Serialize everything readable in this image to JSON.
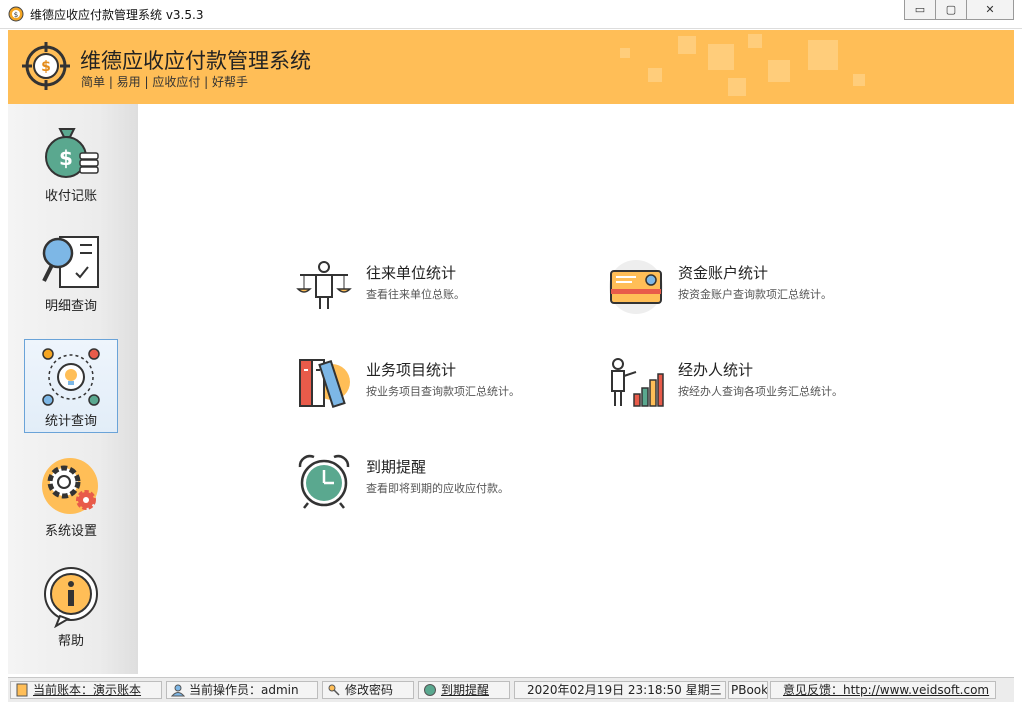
{
  "window": {
    "title": "维德应收应付款管理系统   v3.5.3",
    "controls": {
      "minimize": "▭",
      "maximize": "▢",
      "close": "✕"
    }
  },
  "header": {
    "title": "维德应收应付款管理系统",
    "subtitle": "简单 | 易用 | 应收应付 | 好帮手",
    "accent": "#ffbe57"
  },
  "sidebar": {
    "items": [
      {
        "label": "收付记账",
        "icon": "money-bag-icon"
      },
      {
        "label": "明细查询",
        "icon": "magnifier-report-icon"
      },
      {
        "label": "统计查询",
        "icon": "lightbulb-stats-icon",
        "active": true
      },
      {
        "label": "系统设置",
        "icon": "gears-icon"
      },
      {
        "label": "帮助",
        "icon": "info-icon"
      }
    ]
  },
  "main": {
    "cards": [
      {
        "title": "往来单位统计",
        "desc": "查看往来单位总账。",
        "icon": "scale-person-icon"
      },
      {
        "title": "资金账户统计",
        "desc": "按资金账户查询款项汇总统计。",
        "icon": "bank-card-icon"
      },
      {
        "title": "业务项目统计",
        "desc": "按业务项目查询款项汇总统计。",
        "icon": "binders-icon"
      },
      {
        "title": "经办人统计",
        "desc": "按经办人查询各项业务汇总统计。",
        "icon": "presenter-chart-icon"
      },
      {
        "title": "到期提醒",
        "desc": "查看即将到期的应收应付款。",
        "icon": "alarm-clock-icon"
      }
    ]
  },
  "statusbar": {
    "account": "当前账本：演示账本",
    "operator": "当前操作员：admin",
    "change_password": "修改密码",
    "due_reminder": "到期提醒",
    "datetime": "2020年02月19日  23:18:50  星期三",
    "partial": "PBook\\",
    "feedback": "意见反馈：http://www.veidsoft.com"
  }
}
